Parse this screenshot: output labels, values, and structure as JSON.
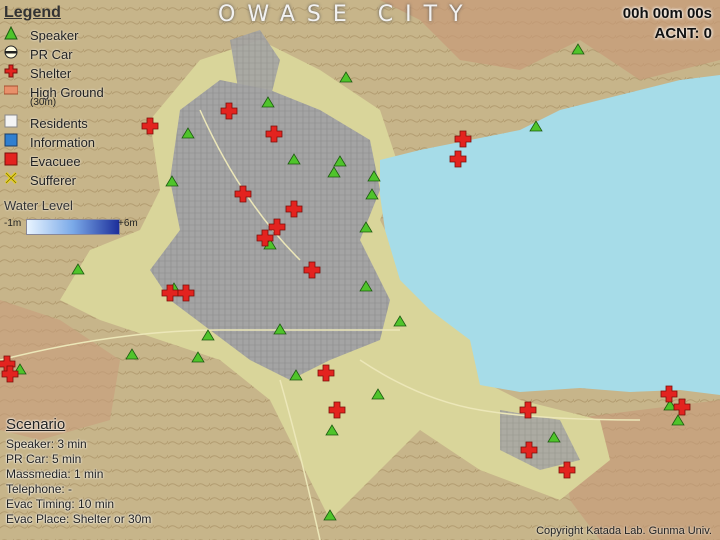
{
  "map": {
    "title": "OWASE CITY",
    "clock": "00h 00m 00s",
    "acnt": "ACNT: 0",
    "copyright": "Copyright Katada Lab. Gunma Univ.",
    "colors": {
      "terrain": "#c9b98c",
      "plain": "#d9d59a",
      "sea": "#a6dce8",
      "urban": "#9e9e9e",
      "speaker": "#4fc42b",
      "shelter": "#e3231f"
    }
  },
  "legend": {
    "title": "Legend",
    "items": [
      {
        "key": "speaker",
        "label": "Speaker",
        "icon": "green-triangle"
      },
      {
        "key": "prcar",
        "label": "PR Car",
        "icon": "striped-circle"
      },
      {
        "key": "shelter",
        "label": "Shelter",
        "icon": "red-cross"
      },
      {
        "key": "highground",
        "label": "High Ground",
        "icon": "orange-swatch"
      }
    ],
    "highground_note": "(30m)",
    "items2": [
      {
        "key": "residents",
        "label": "Residents",
        "icon": "white-square"
      },
      {
        "key": "information",
        "label": "Information",
        "icon": "blue-square"
      },
      {
        "key": "evacuee",
        "label": "Evacuee",
        "icon": "red-square"
      },
      {
        "key": "sufferer",
        "label": "Sufferer",
        "icon": "yellow-x"
      }
    ],
    "water_level": {
      "title": "Water Level",
      "min": "-1m",
      "max": "+6m"
    }
  },
  "scenario": {
    "title": "Scenario",
    "lines": [
      "Speaker: 3 min",
      "PR Car: 5 min",
      "Massmedia: 1 min",
      "Telephone: -",
      "Evac Timing: 10 min",
      "Evac Place: Shelter or 30m"
    ]
  }
}
